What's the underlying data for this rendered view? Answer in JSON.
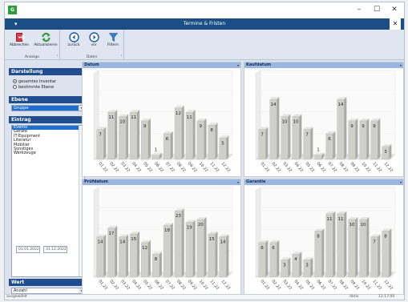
{
  "window": {
    "title": "Termine & Fristen",
    "app_icon_text": "G",
    "minimize_glyph": "–",
    "maximize_glyph": "☐",
    "close_glyph": "✕",
    "inner_close_glyph": "✕",
    "menu_glyph": "▾"
  },
  "ribbon": {
    "groups": [
      {
        "name": "Anzeige",
        "buttons": [
          {
            "label": "Abbrechen",
            "icon": "exit-icon"
          },
          {
            "label": "Aktualisieren",
            "icon": "refresh-icon"
          }
        ]
      },
      {
        "name": "Daten",
        "buttons": [
          {
            "label": "zurück",
            "icon": "back-arrow-icon"
          },
          {
            "label": "vor",
            "icon": "forward-arrow-icon"
          },
          {
            "label": "Filtern",
            "icon": "filter-icon"
          }
        ]
      }
    ],
    "expander_glyph": "⌝"
  },
  "sidebar": {
    "darstellung": {
      "title": "Darstellung",
      "options": [
        {
          "label": "gesamtes Inventar",
          "selected": true
        },
        {
          "label": "bestimmte Ebene",
          "selected": false
        }
      ]
    },
    "ebene": {
      "title": "Ebene",
      "value": "Gruppe"
    },
    "eintrag": {
      "title": "Eintrag",
      "items": [
        "Events",
        "Geräte",
        "IT-Equipment",
        "Literatur",
        "Mobiliar",
        "Sonstiges",
        "Werkzeuge"
      ],
      "selected_index": 0
    },
    "wert": {
      "title": "Wert",
      "value": "Anzahl"
    },
    "date_from": "01.01.2022",
    "date_to": "31.12.2022",
    "arrow_glyph": "▾",
    "scroll_up_glyph": "˄",
    "scroll_down_glyph": "˅"
  },
  "statusbar": {
    "left": "ausgewählt",
    "right_1": "Aktiv",
    "right_2": "12:17:00"
  },
  "chart_data": [
    {
      "type": "bar",
      "title": "Datum",
      "categories": [
        "01.22",
        "02.22",
        "03.22",
        "04.22",
        "05.22",
        "06.22",
        "07.22",
        "08.22",
        "09.22",
        "10.22",
        "11.22",
        "12.22"
      ],
      "values": [
        7,
        11,
        10,
        11,
        9,
        1,
        6,
        12,
        11,
        9,
        8,
        5
      ],
      "ylim": [
        0,
        20
      ],
      "bar_color": "#cfcfcb"
    },
    {
      "type": "bar",
      "title": "Kaufdatum",
      "categories": [
        "01.22",
        "02.22",
        "03.22",
        "04.22",
        "05.22",
        "06.22",
        "07.22",
        "08.22",
        "09.22",
        "10.22",
        "11.22",
        "12.22"
      ],
      "values": [
        7,
        14,
        10,
        10,
        7,
        1,
        6,
        14,
        9,
        9,
        9,
        3
      ],
      "ylim": [
        0,
        20
      ],
      "bar_color": "#cfcfcb"
    },
    {
      "type": "bar",
      "title": "Prüfdatum",
      "categories": [
        "01.22",
        "02.22",
        "03.22",
        "04.22",
        "05.22",
        "06.22",
        "07.22",
        "08.22",
        "09.22",
        "10.22",
        "11.22",
        "12.22"
      ],
      "values": [
        14,
        17,
        14,
        15,
        12,
        8,
        18,
        23,
        19,
        20,
        15,
        14
      ],
      "ylim": [
        0,
        30
      ],
      "bar_color": "#cfcfcb"
    },
    {
      "type": "bar",
      "title": "Garantie",
      "categories": [
        "01.22",
        "02.22",
        "03.22",
        "04.22",
        "05.22",
        "06.22",
        "07.22",
        "08.22",
        "09.22",
        "10.22",
        "11.22",
        "12.22"
      ],
      "values": [
        6,
        6,
        3,
        4,
        3,
        8,
        11,
        11,
        10,
        10,
        7,
        8
      ],
      "ylim": [
        0,
        15
      ],
      "bar_color": "#cfcfcb"
    }
  ]
}
